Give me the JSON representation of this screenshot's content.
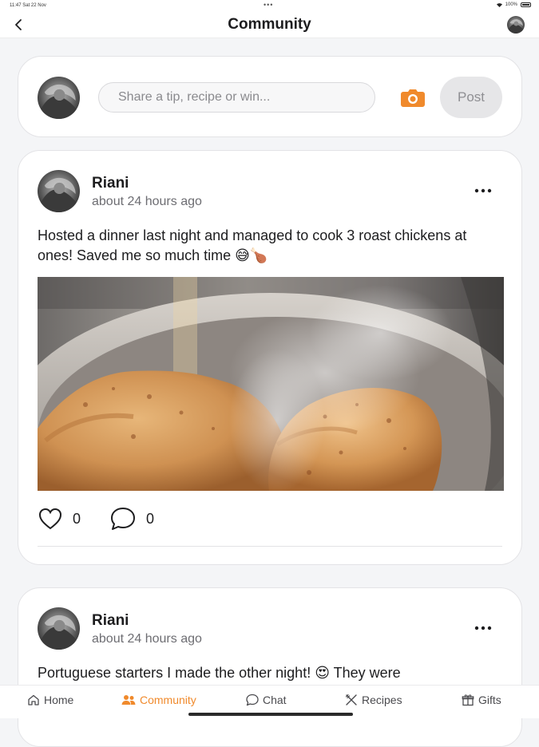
{
  "status_bar": {
    "time": "11:47  Sat 22 Nov",
    "dots": "•••",
    "battery": "100%"
  },
  "header": {
    "title": "Community",
    "back_icon": "chevron-left-icon",
    "avatar_icon": "avatar"
  },
  "composer": {
    "placeholder": "Share a tip, recipe or win...",
    "camera_icon": "camera-icon",
    "post_label": "Post",
    "accent": "#F08A2C"
  },
  "posts": [
    {
      "author": "Riani",
      "time": "about 24 hours ago",
      "text": "Hosted a dinner last night and managed to cook 3 roast chickens at ones! Saved me so much time 😅🍗",
      "likes": "0",
      "comments": "0"
    },
    {
      "author": "Riani",
      "time": "about 24 hours ago",
      "text": "Portuguese starters I made the other night! 😍 They were"
    }
  ],
  "tabs": [
    {
      "label": "Home",
      "icon": "home-icon",
      "active": false
    },
    {
      "label": "Community",
      "icon": "people-icon",
      "active": true
    },
    {
      "label": "Chat",
      "icon": "chat-icon",
      "active": false
    },
    {
      "label": "Recipes",
      "icon": "utensils-icon",
      "active": false
    },
    {
      "label": "Gifts",
      "icon": "gift-icon",
      "active": false
    }
  ],
  "colors": {
    "accent": "#F08A2C",
    "background": "#F4F5F7",
    "card": "#FFFFFF"
  }
}
